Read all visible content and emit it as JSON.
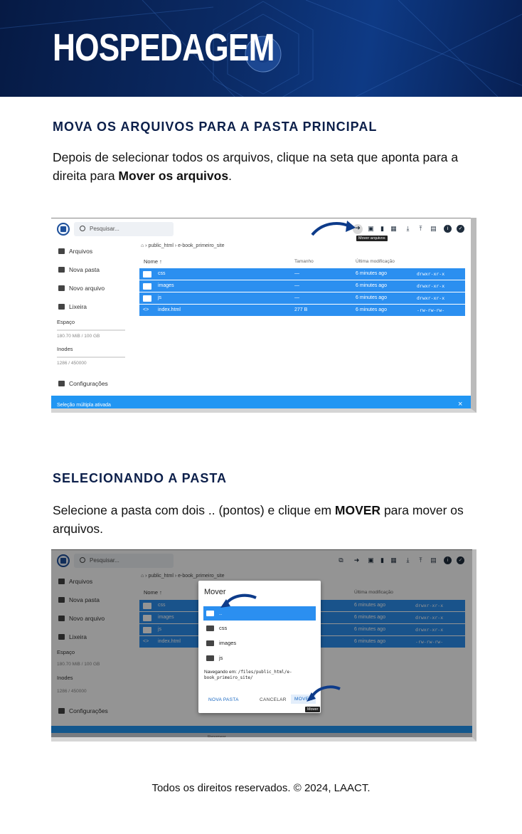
{
  "banner": {
    "title": "HOSPEDAGEM"
  },
  "section1": {
    "heading": "MOVA OS ARQUIVOS PARA A PASTA PRINCIPAL",
    "text_before": "Depois de selecionar todos os arquivos, clique na seta que aponta para a direita para ",
    "text_bold": "Mover os arquivos",
    "text_after": "."
  },
  "section2": {
    "heading": "SELECIONANDO A PASTA",
    "text_before": "Selecione a pasta com dois .. (pontos) e clique em ",
    "text_bold": "MOVER",
    "text_after": " para mover os arquivos."
  },
  "filemanager": {
    "search_placeholder": "Pesquisar...",
    "sidebar": {
      "files": "Arquivos",
      "new_folder": "Nova pasta",
      "new_file": "Novo arquivo",
      "trash": "Lixeira",
      "space_label": "Espaço",
      "space_value": "180.70 MiB / 100 GB",
      "inodes_label": "Inodes",
      "inodes_value": "1286 / 450000",
      "settings": "Configurações"
    },
    "breadcrumb": {
      "root": "public_html",
      "current": "e-book_primeiro_site"
    },
    "columns": {
      "name": "Nome",
      "size": "Tamanho",
      "modified": "Última modificação"
    },
    "rows": [
      {
        "name": "css",
        "size": "—",
        "modified": "6 minutes ago",
        "perms": "drwxr-xr-x"
      },
      {
        "name": "images",
        "size": "—",
        "modified": "6 minutes ago",
        "perms": "drwxr-xr-x"
      },
      {
        "name": "js",
        "size": "—",
        "modified": "6 minutes ago",
        "perms": "drwxr-xr-x"
      },
      {
        "name": "index.html",
        "size": "277 B",
        "modified": "6 minutes ago",
        "perms": "-rw-rw-rw-"
      }
    ],
    "tooltip_move": "Mover arquivos",
    "multi_select": "Seleção múltipla ativada",
    "rename": "Renomear",
    "close": "×"
  },
  "dialog": {
    "title": "Mover",
    "items": [
      "..",
      "css",
      "images",
      "js"
    ],
    "navigating_label": "Navegando em:",
    "navigating_path": "/files/public_html/e-book_primeiro_site/",
    "new_folder": "NOVA PASTA",
    "cancel": "CANCELAR",
    "move": "MOVER",
    "move_tooltip": "Mover"
  },
  "colors": {
    "banner": "#0b2b66",
    "accent": "#2b8ff0",
    "heading": "#0c1f4a",
    "arrow": "#0d3b8a"
  },
  "footer": "Todos os direitos reservados. © 2024, LAACT."
}
